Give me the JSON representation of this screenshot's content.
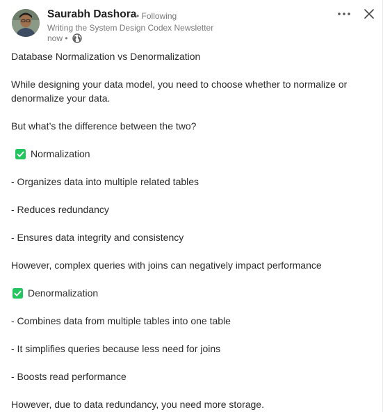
{
  "author": {
    "name": "Saurabh Dashora",
    "follow_status": "• Following",
    "tagline": "Writing the System Design Codex Newsletter",
    "time": "now •"
  },
  "icons": {
    "more": "more-horizontal-icon",
    "close": "close-icon",
    "visibility": "globe-icon",
    "check": "check-box-icon",
    "check_color": "#22c55e"
  },
  "post": {
    "title": "Database Normalization vs Denormalization",
    "intro_line1": "While designing your data model, you need to choose whether to normalize or",
    "intro_line2": "denormalize your data.",
    "question": "But what’s the difference between the two?",
    "normalization_heading": "Normalization",
    "normalization_points": [
      "- Organizes data into multiple related tables",
      "- Reduces redundancy",
      "- Ensures data integrity and consistency"
    ],
    "normalization_caveat": "However, complex queries with joins can negatively impact performance",
    "denormalization_heading": "Denormalization",
    "denormalization_points": [
      "- Combines data from multiple tables into one table",
      "- It simplifies queries because less need for joins",
      "- Boosts read performance"
    ],
    "denormalization_caveat": "However, due to data redundancy, you need more storage."
  }
}
